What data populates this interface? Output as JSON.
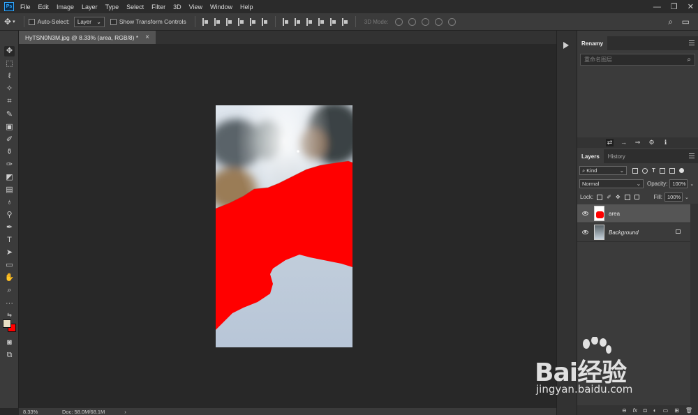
{
  "app": {
    "logo_text": "Ps",
    "menu": [
      "File",
      "Edit",
      "Image",
      "Layer",
      "Type",
      "Select",
      "Filter",
      "3D",
      "View",
      "Window",
      "Help"
    ],
    "window_controls": {
      "minimize": "—",
      "restore": "❐",
      "close": "✕"
    }
  },
  "options_bar": {
    "auto_select_label": "Auto-Select:",
    "auto_select_target": "Layer",
    "show_transform_label": "Show Transform Controls",
    "mode_label": "3D Mode:",
    "search_icon": "search-icon",
    "workspace_icon": "workspace-icon"
  },
  "document": {
    "tab_title": "HyTSN0N3M.jpg @ 8.33% (area, RGB/8) *",
    "close_glyph": "×",
    "zoom": "8.33%",
    "doc_size": "Doc: 58.0M/68.1M",
    "status_arrow": "›"
  },
  "renamy_panel": {
    "tab": "Renamy",
    "search_placeholder": "重命名图层",
    "search_glyph": "⌕",
    "tool_icons": [
      "⇄",
      "→",
      "⇒",
      "⚙",
      "ℹ"
    ]
  },
  "layers_panel": {
    "tabs": [
      "Layers",
      "History"
    ],
    "filter_kind": "Kind",
    "blend_mode": "Normal",
    "opacity_label": "Opacity:",
    "opacity_value": "100%",
    "lock_label": "Lock:",
    "fill_label": "Fill:",
    "fill_value": "100%",
    "layers": [
      {
        "name": "area",
        "selected": true,
        "locked": false
      },
      {
        "name": "Background",
        "selected": false,
        "locked": true
      }
    ],
    "footer_icons": [
      "⊖",
      "fx",
      "◘",
      "◐",
      "▭",
      "⊞",
      "🗑"
    ]
  },
  "colors": {
    "foreground": "#e8dfc4",
    "background": "#ff0000",
    "paint": "#ff0000"
  },
  "watermark": {
    "brand": "Bai经验",
    "url": "jingyan.baidu.com"
  }
}
